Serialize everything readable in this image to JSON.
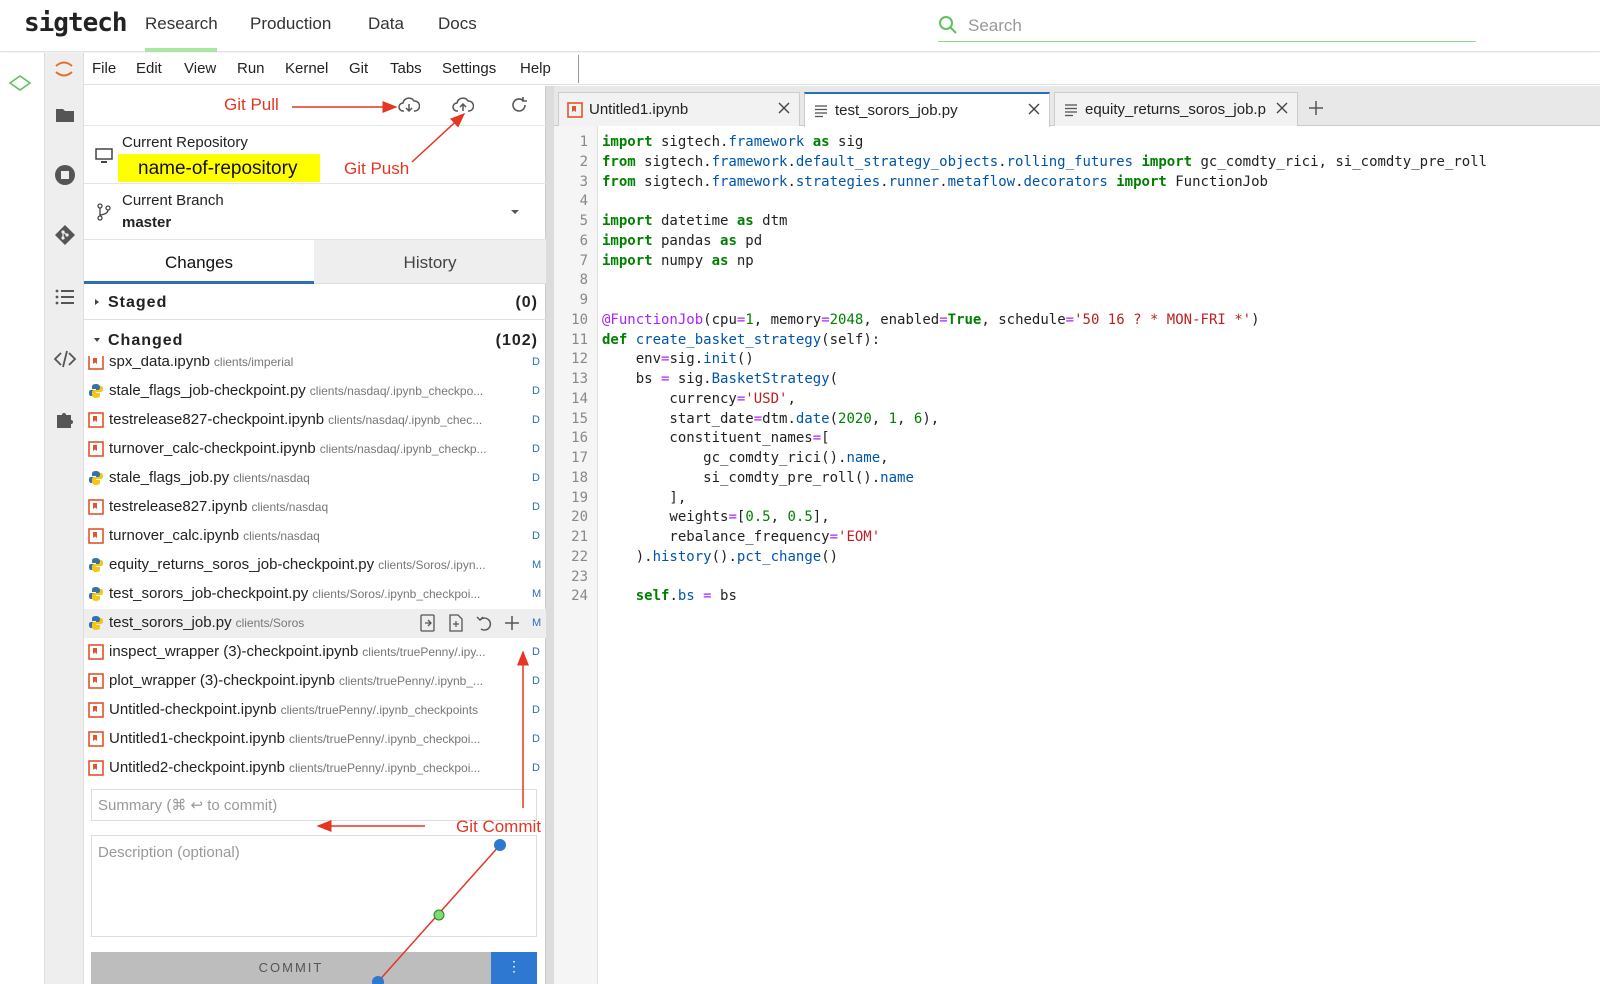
{
  "topnav": {
    "logo": "sigtech",
    "links": [
      "Research",
      "Production",
      "Data",
      "Docs"
    ],
    "active": "Research",
    "search_placeholder": "Search"
  },
  "menubar": {
    "items": [
      "File",
      "Edit",
      "View",
      "Run",
      "Kernel",
      "Git",
      "Tabs",
      "Settings",
      "Help"
    ]
  },
  "git": {
    "current_repository_label": "Current Repository",
    "repository_name": "name-of-repository",
    "current_branch_label": "Current Branch",
    "branch_name": "master",
    "tabs": [
      "Changes",
      "History"
    ],
    "staged_label": "Staged",
    "staged_count": "(0)",
    "changed_label": "Changed",
    "changed_count": "(102)",
    "files": [
      {
        "name": "spx_data.ipynb",
        "path": "clients/imperial",
        "status": "D",
        "type": "notebook"
      },
      {
        "name": "stale_flags_job-checkpoint.py",
        "path": "clients/nasdaq/.ipynb_checkpo...",
        "status": "D",
        "type": "python"
      },
      {
        "name": "testrelease827-checkpoint.ipynb",
        "path": "clients/nasdaq/.ipynb_chec...",
        "status": "D",
        "type": "notebook"
      },
      {
        "name": "turnover_calc-checkpoint.ipynb",
        "path": "clients/nasdaq/.ipynb_checkp...",
        "status": "D",
        "type": "notebook"
      },
      {
        "name": "stale_flags_job.py",
        "path": "clients/nasdaq",
        "status": "D",
        "type": "python"
      },
      {
        "name": "testrelease827.ipynb",
        "path": "clients/nasdaq",
        "status": "D",
        "type": "notebook"
      },
      {
        "name": "turnover_calc.ipynb",
        "path": "clients/nasdaq",
        "status": "D",
        "type": "notebook"
      },
      {
        "name": "equity_returns_soros_job-checkpoint.py",
        "path": "clients/Soros/.ipyn...",
        "status": "M",
        "type": "python"
      },
      {
        "name": "test_sorors_job-checkpoint.py",
        "path": "clients/Soros/.ipynb_checkpoi...",
        "status": "M",
        "type": "python"
      },
      {
        "name": "test_sorors_job.py",
        "path": "clients/Soros",
        "status": "M",
        "type": "python"
      },
      {
        "name": "inspect_wrapper (3)-checkpoint.ipynb",
        "path": "clients/truePenny/.ipy...",
        "status": "D",
        "type": "notebook"
      },
      {
        "name": "plot_wrapper (3)-checkpoint.ipynb",
        "path": "clients/truePenny/.ipynb_...",
        "status": "D",
        "type": "notebook"
      },
      {
        "name": "Untitled-checkpoint.ipynb",
        "path": "clients/truePenny/.ipynb_checkpoints",
        "status": "D",
        "type": "notebook"
      },
      {
        "name": "Untitled1-checkpoint.ipynb",
        "path": "clients/truePenny/.ipynb_checkpoi...",
        "status": "D",
        "type": "notebook"
      },
      {
        "name": "Untitled2-checkpoint.ipynb",
        "path": "clients/truePenny/.ipynb_checkpoi...",
        "status": "D",
        "type": "notebook"
      }
    ],
    "summary_placeholder": "Summary (⌘ ↩ to commit)",
    "description_placeholder": "Description (optional)",
    "commit_label": "COMMIT"
  },
  "editor": {
    "tabs": [
      "Untitled1.ipynb",
      "test_sorors_job.py",
      "equity_returns_soros_job.p"
    ],
    "active_tab": "test_sorors_job.py",
    "line_numbers": [
      "1",
      "2",
      "3",
      "4",
      "5",
      "6",
      "7",
      "8",
      "9",
      "10",
      "11",
      "12",
      "13",
      "14",
      "15",
      "16",
      "17",
      "18",
      "19",
      "20",
      "21",
      "22",
      "23",
      "24"
    ]
  },
  "annotations": {
    "git_pull": "Git Pull",
    "git_push": "Git Push",
    "git_commit": "Git Commit"
  },
  "colors": {
    "accent_green": "#a9e7a2",
    "accent_blue": "#2d6fb7",
    "highlight_yellow": "#ffff00",
    "annotation_red": "#e53524"
  }
}
